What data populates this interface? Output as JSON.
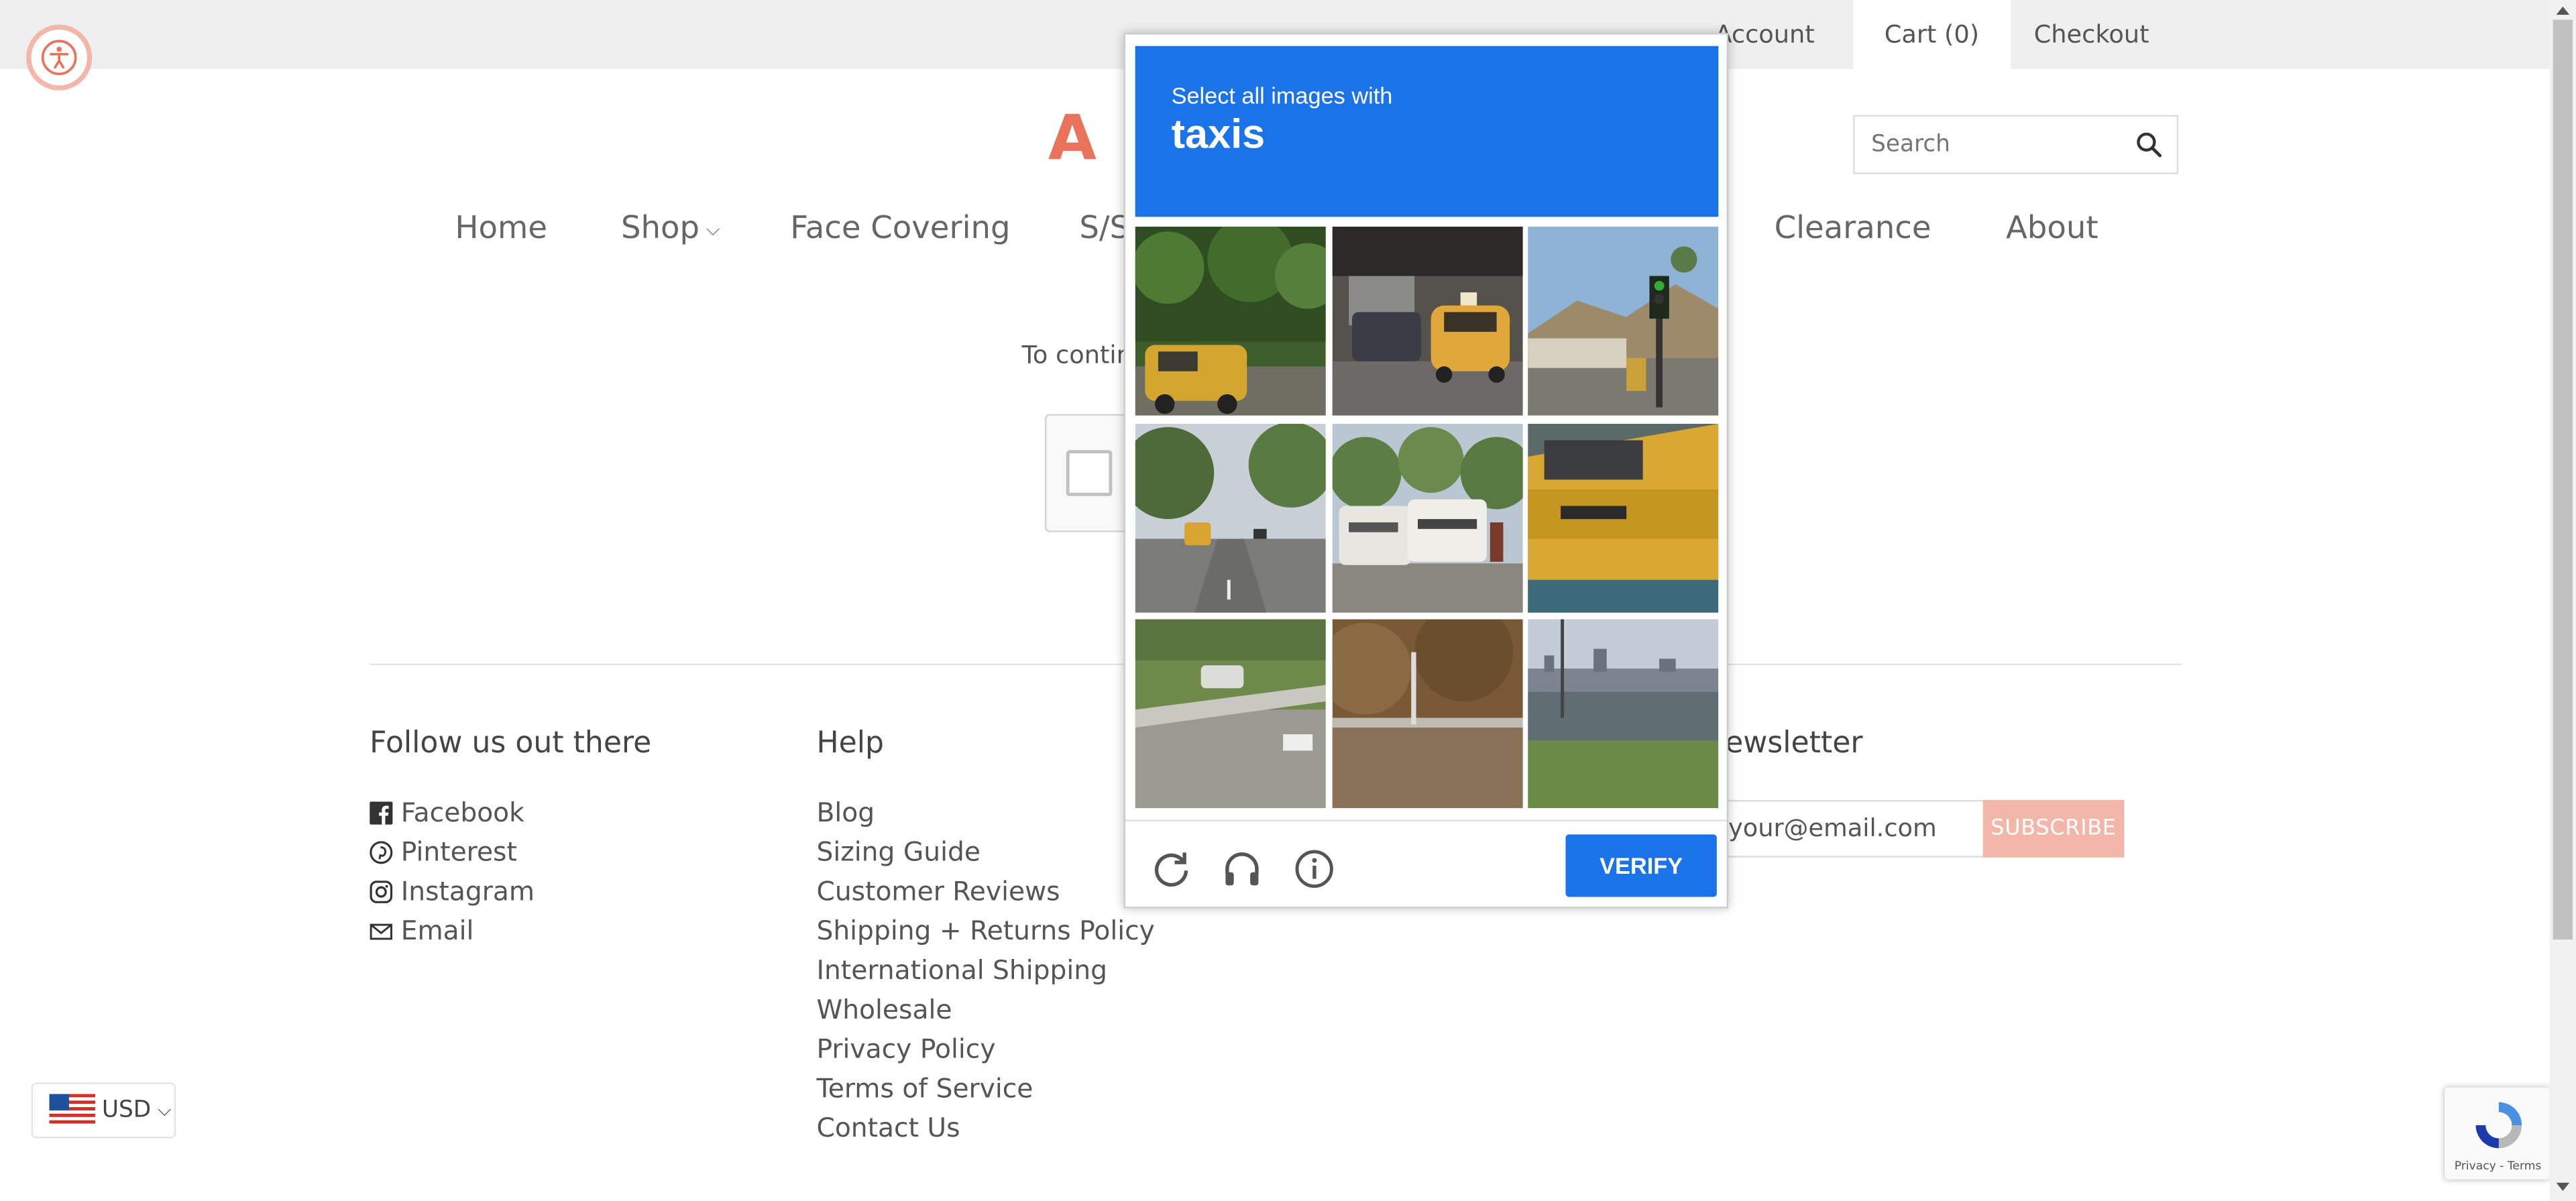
{
  "topbar": {
    "account_label": "Account",
    "cart_label": "Cart (0)",
    "checkout_label": "Checkout"
  },
  "logo": {
    "text": "A L"
  },
  "search": {
    "placeholder": "Search"
  },
  "nav": {
    "items": [
      "Home",
      "Shop",
      "Face Covering",
      "S/S",
      "Clearance",
      "About"
    ]
  },
  "page": {
    "continue_text": "To contin"
  },
  "footer": {
    "follow_heading": "Follow us out there",
    "social": [
      "Facebook",
      "Pinterest",
      "Instagram",
      "Email"
    ],
    "help_heading": "Help",
    "help_links": [
      "Blog",
      "Sizing Guide",
      "Customer Reviews",
      "Shipping + Returns Policy",
      "International Shipping",
      "Wholesale",
      "Privacy Policy",
      "Terms of Service",
      "Contact Us"
    ],
    "newsletter_heading": "ewsletter",
    "email_placeholder": "your@email.com",
    "subscribe_label": "SUBSCRIBE"
  },
  "currency": {
    "code": "USD"
  },
  "recaptcha": {
    "terms": "Privacy - Terms"
  },
  "challenge": {
    "prompt": "Select all images with",
    "target": "taxis",
    "verify_label": "VERIFY",
    "tiles": [
      "yellow taxi on tree-lined road",
      "yellow taxi in traffic under bridge",
      "traffic light near mountain road",
      "road with trees and bus",
      "parked RVs and trucks",
      "close-up yellow taxi",
      "highway guardrail with car",
      "guardrail with dry trees",
      "water and marsh with city skyline"
    ]
  },
  "colors": {
    "brand": "#e8735a",
    "captcha_blue": "#1a73e8",
    "subscribe_bg": "#f2b7a8"
  }
}
